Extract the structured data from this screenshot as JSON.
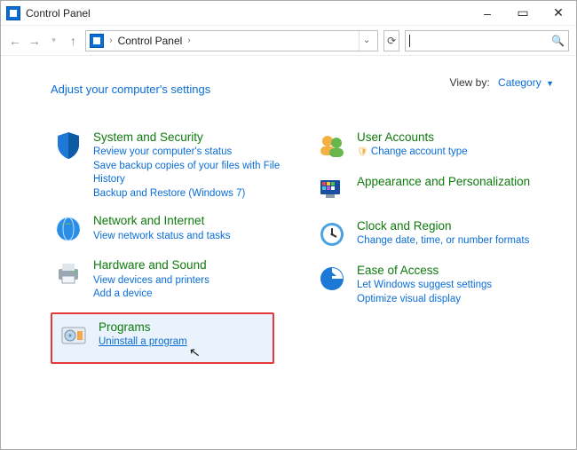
{
  "window": {
    "title": "Control Panel"
  },
  "nav": {
    "breadcrumb_root": "Control Panel",
    "search_placeholder": ""
  },
  "header": {
    "headline": "Adjust your computer's settings",
    "viewby_label": "View by:",
    "viewby_value": "Category"
  },
  "left": {
    "system": {
      "title": "System and Security",
      "l1": "Review your computer's status",
      "l2": "Save backup copies of your files with File History",
      "l3": "Backup and Restore (Windows 7)"
    },
    "network": {
      "title": "Network and Internet",
      "l1": "View network status and tasks"
    },
    "hardware": {
      "title": "Hardware and Sound",
      "l1": "View devices and printers",
      "l2": "Add a device"
    },
    "programs": {
      "title": "Programs",
      "l1": "Uninstall a program"
    }
  },
  "right": {
    "users": {
      "title": "User Accounts",
      "l1": "Change account type"
    },
    "appearance": {
      "title": "Appearance and Personalization"
    },
    "clock": {
      "title": "Clock and Region",
      "l1": "Change date, time, or number formats"
    },
    "ease": {
      "title": "Ease of Access",
      "l1": "Let Windows suggest settings",
      "l2": "Optimize visual display"
    }
  }
}
